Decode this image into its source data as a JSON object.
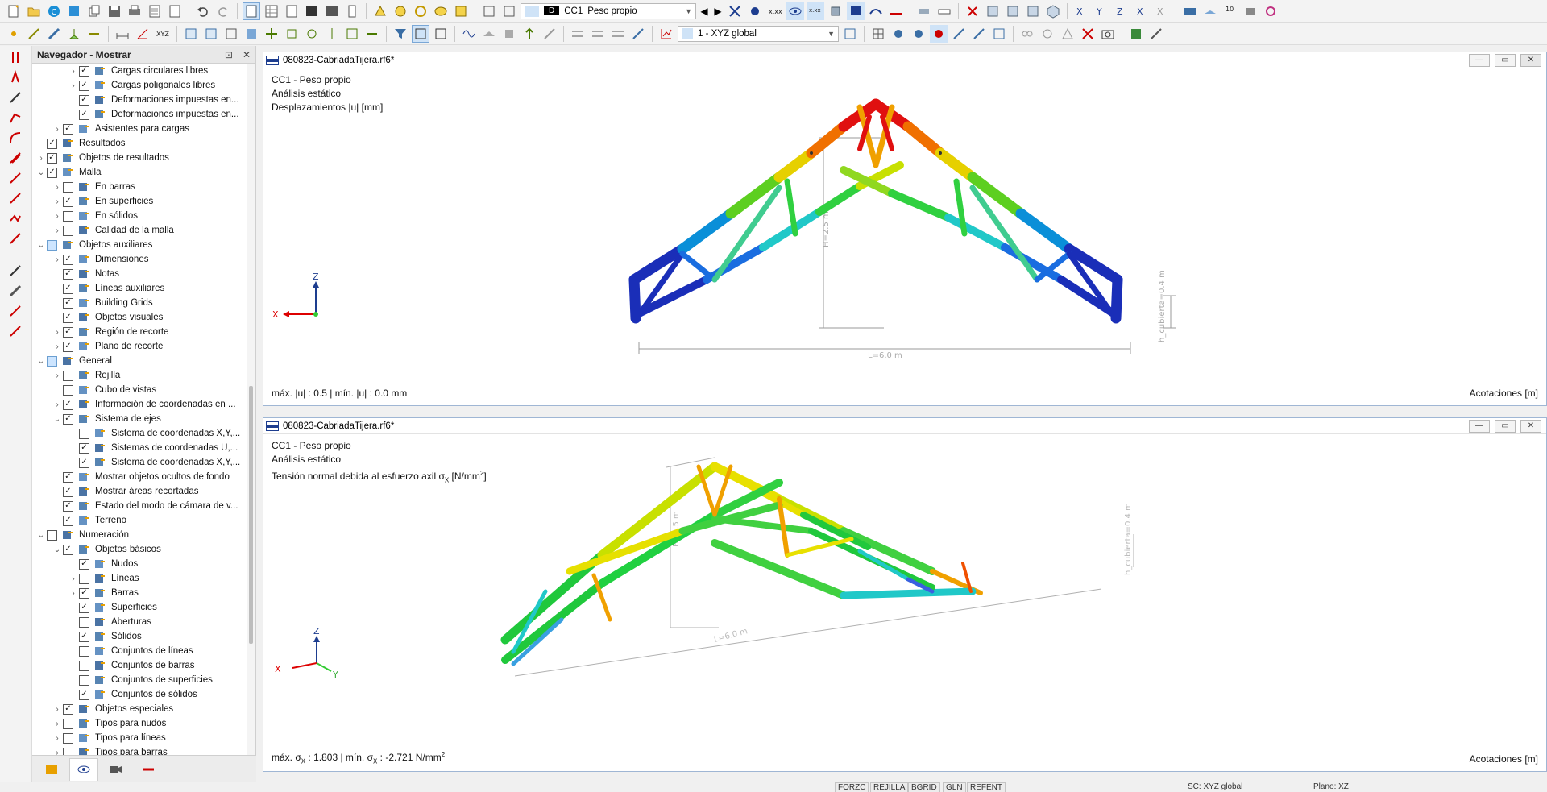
{
  "toolbar": {
    "combo_case_tag": "D",
    "combo_case_id": "CC1",
    "combo_case_name": "Peso propio",
    "combo_coord": "1 - XYZ global"
  },
  "navigator": {
    "title": "Navegador - Mostrar",
    "items": [
      {
        "level": 2,
        "exp": "›",
        "check": "checked",
        "label": "Cargas circulares libres"
      },
      {
        "level": 2,
        "exp": "›",
        "check": "checked",
        "label": "Cargas poligonales libres"
      },
      {
        "level": 2,
        "exp": "",
        "check": "checked",
        "label": "Deformaciones impuestas en..."
      },
      {
        "level": 2,
        "exp": "",
        "check": "checked",
        "label": "Deformaciones impuestas en..."
      },
      {
        "level": 1,
        "exp": "›",
        "check": "checked",
        "label": "Asistentes para cargas"
      },
      {
        "level": 0,
        "exp": "",
        "check": "checked",
        "label": "Resultados"
      },
      {
        "level": 0,
        "exp": "›",
        "check": "checked",
        "label": "Objetos de resultados"
      },
      {
        "level": 0,
        "exp": "⌄",
        "check": "checked",
        "label": "Malla"
      },
      {
        "level": 1,
        "exp": "›",
        "check": "unchecked",
        "label": "En barras"
      },
      {
        "level": 1,
        "exp": "›",
        "check": "checked",
        "label": "En superficies"
      },
      {
        "level": 1,
        "exp": "›",
        "check": "unchecked",
        "label": "En sólidos"
      },
      {
        "level": 1,
        "exp": "›",
        "check": "unchecked",
        "label": "Calidad de la malla"
      },
      {
        "level": 0,
        "exp": "⌄",
        "check": "partial",
        "label": "Objetos auxiliares"
      },
      {
        "level": 1,
        "exp": "›",
        "check": "checked",
        "label": "Dimensiones"
      },
      {
        "level": 1,
        "exp": "",
        "check": "checked",
        "label": "Notas"
      },
      {
        "level": 1,
        "exp": "",
        "check": "checked",
        "label": "Líneas auxiliares"
      },
      {
        "level": 1,
        "exp": "",
        "check": "checked",
        "label": "Building Grids"
      },
      {
        "level": 1,
        "exp": "",
        "check": "checked",
        "label": "Objetos visuales"
      },
      {
        "level": 1,
        "exp": "›",
        "check": "checked",
        "label": "Región de recorte"
      },
      {
        "level": 1,
        "exp": "›",
        "check": "checked",
        "label": "Plano de recorte"
      },
      {
        "level": 0,
        "exp": "⌄",
        "check": "partial",
        "label": "General"
      },
      {
        "level": 1,
        "exp": "›",
        "check": "unchecked",
        "label": "Rejilla"
      },
      {
        "level": 1,
        "exp": "",
        "check": "unchecked",
        "label": "Cubo de vistas"
      },
      {
        "level": 1,
        "exp": "›",
        "check": "checked",
        "label": "Información de coordenadas en ..."
      },
      {
        "level": 1,
        "exp": "⌄",
        "check": "checked",
        "label": "Sistema de ejes"
      },
      {
        "level": 2,
        "exp": "",
        "check": "unchecked",
        "label": "Sistema de coordenadas X,Y,..."
      },
      {
        "level": 2,
        "exp": "",
        "check": "checked",
        "label": "Sistemas de coordenadas U,..."
      },
      {
        "level": 2,
        "exp": "",
        "check": "checked",
        "label": "Sistema de coordenadas X,Y,..."
      },
      {
        "level": 1,
        "exp": "",
        "check": "checked",
        "label": "Mostrar objetos ocultos de fondo"
      },
      {
        "level": 1,
        "exp": "",
        "check": "checked",
        "label": "Mostrar áreas recortadas"
      },
      {
        "level": 1,
        "exp": "",
        "check": "checked",
        "label": "Estado del modo de cámara de v..."
      },
      {
        "level": 1,
        "exp": "",
        "check": "checked",
        "label": "Terreno"
      },
      {
        "level": 0,
        "exp": "⌄",
        "check": "unchecked",
        "label": "Numeración"
      },
      {
        "level": 1,
        "exp": "⌄",
        "check": "checked",
        "label": "Objetos básicos"
      },
      {
        "level": 2,
        "exp": "",
        "check": "checked",
        "label": "Nudos"
      },
      {
        "level": 2,
        "exp": "›",
        "check": "unchecked",
        "label": "Líneas"
      },
      {
        "level": 2,
        "exp": "›",
        "check": "checked",
        "label": "Barras"
      },
      {
        "level": 2,
        "exp": "",
        "check": "checked",
        "label": "Superficies"
      },
      {
        "level": 2,
        "exp": "",
        "check": "unchecked",
        "label": "Aberturas"
      },
      {
        "level": 2,
        "exp": "",
        "check": "checked",
        "label": "Sólidos"
      },
      {
        "level": 2,
        "exp": "",
        "check": "unchecked",
        "label": "Conjuntos de líneas"
      },
      {
        "level": 2,
        "exp": "",
        "check": "unchecked",
        "label": "Conjuntos de barras"
      },
      {
        "level": 2,
        "exp": "",
        "check": "unchecked",
        "label": "Conjuntos de superficies"
      },
      {
        "level": 2,
        "exp": "",
        "check": "checked",
        "label": "Conjuntos de sólidos"
      },
      {
        "level": 1,
        "exp": "›",
        "check": "checked",
        "label": "Objetos especiales"
      },
      {
        "level": 1,
        "exp": "›",
        "check": "unchecked",
        "label": "Tipos para nudos"
      },
      {
        "level": 1,
        "exp": "›",
        "check": "unchecked",
        "label": "Tipos para líneas"
      },
      {
        "level": 1,
        "exp": "›",
        "check": "unchecked",
        "label": "Tipos para barras"
      }
    ]
  },
  "view1": {
    "file": "080823-CabriadaTijera.rf6*",
    "line1": "CC1 - Peso propio",
    "line2": "Análisis estático",
    "line3": "Desplazamientos |u| [mm]",
    "footer_left": "máx. |u| : 0.5 | mín. |u| : 0.0 mm",
    "footer_right": "Acotaciones [m]",
    "dim_h": "H=2.5 m",
    "dim_l": "L=6.0 m",
    "dim_hc": "h_cubierta=0.4 m",
    "axis_z": "Z",
    "axis_x": "X"
  },
  "view2": {
    "file": "080823-CabriadaTijera.rf6*",
    "line1": "CC1 - Peso propio",
    "line2": "Análisis estático",
    "line3_pre": "Tensión normal debida al esfuerzo axil σ",
    "line3_sub": "X",
    "line3_post": " [N/mm",
    "line3_sup": "2",
    "line3_end": "]",
    "footer_a": "máx. σ",
    "footer_sub1": "X",
    "footer_b": " : 1.803 | mín. σ",
    "footer_sub2": "X",
    "footer_c": " : -2.721 N/mm",
    "footer_sup": "2",
    "footer_right": "Acotaciones [m]",
    "dim_h": "H=2.5 m",
    "dim_l": "L=6.0 m",
    "dim_hc": "h_cubierta=0.4 m",
    "axis_z": "Z",
    "axis_x": "X",
    "axis_y": "Y"
  },
  "status": {
    "b1": "FORZC",
    "b2": "REJILLA",
    "b3": "BGRID",
    "b4": "GLN",
    "b5": "REFENT",
    "sc": "SC: XYZ global",
    "plano": "Plano: XZ"
  },
  "colors": {
    "accent": "#1d3d8f",
    "disp_max": "#e01010",
    "disp_min": "#101a9c"
  }
}
